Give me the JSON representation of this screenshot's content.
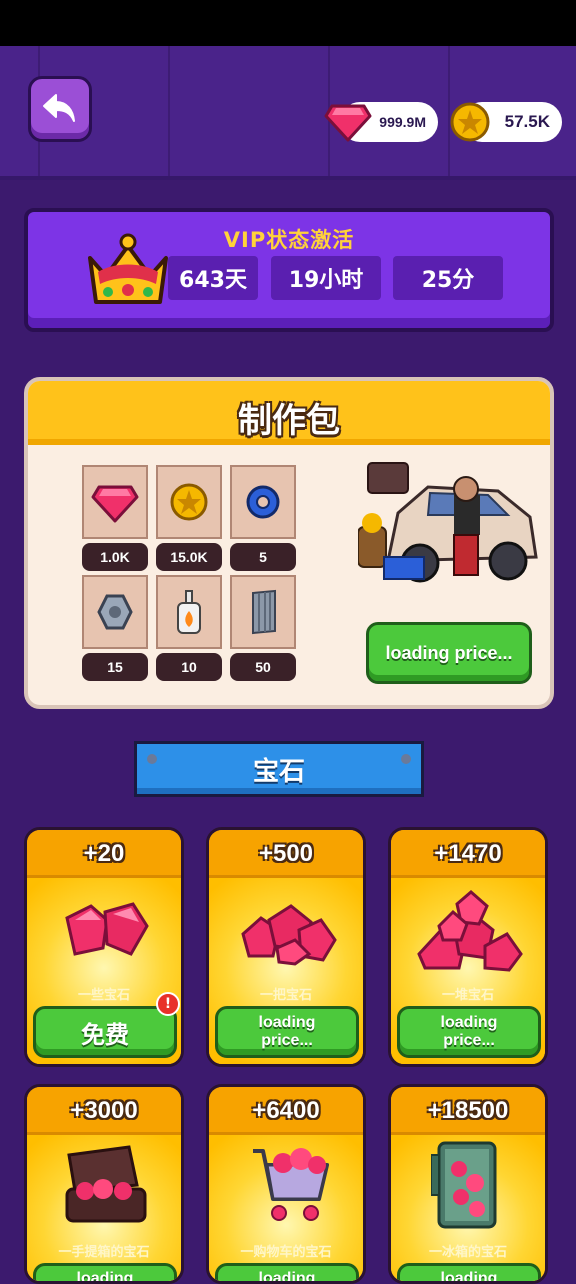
{
  "header": {
    "gems_amount": "999.9M",
    "coins_amount": "57.5K"
  },
  "vip": {
    "title": "VIP状态激活",
    "days": "643天",
    "hours": "19小时",
    "minutes": "25分"
  },
  "crafting_pack": {
    "title": "制作包",
    "items": [
      {
        "icon": "gem-icon",
        "value": "1.0K"
      },
      {
        "icon": "gold-coin-icon",
        "value": "15.0K"
      },
      {
        "icon": "blue-tape-icon",
        "value": "5"
      },
      {
        "icon": "hex-nut-icon",
        "value": "15"
      },
      {
        "icon": "glue-bottle-icon",
        "value": "10"
      },
      {
        "icon": "metal-sheet-icon",
        "value": "50"
      }
    ],
    "price_label": "loading price..."
  },
  "gems_section": {
    "title": "宝石",
    "offers": [
      {
        "amount": "+20",
        "label": "一些宝石",
        "button": "免费",
        "badge": "!"
      },
      {
        "amount": "+500",
        "label": "一把宝石",
        "button": "loading price..."
      },
      {
        "amount": "+1470",
        "label": "一堆宝石",
        "button": "loading price..."
      },
      {
        "amount": "+3000",
        "label": "一手提箱的宝石",
        "button": "loading"
      },
      {
        "amount": "+6400",
        "label": "一购物车的宝石",
        "button": "loading"
      },
      {
        "amount": "+18500",
        "label": "一冰箱的宝石",
        "button": "loading"
      }
    ]
  },
  "colors": {
    "background": "#3c1a6e",
    "vip_panel": "#7d34e6",
    "accent_yellow": "#ffc21a",
    "button_green": "#4cc93c",
    "gem_pink": "#f0306a",
    "banner_blue": "#2d90e8"
  }
}
